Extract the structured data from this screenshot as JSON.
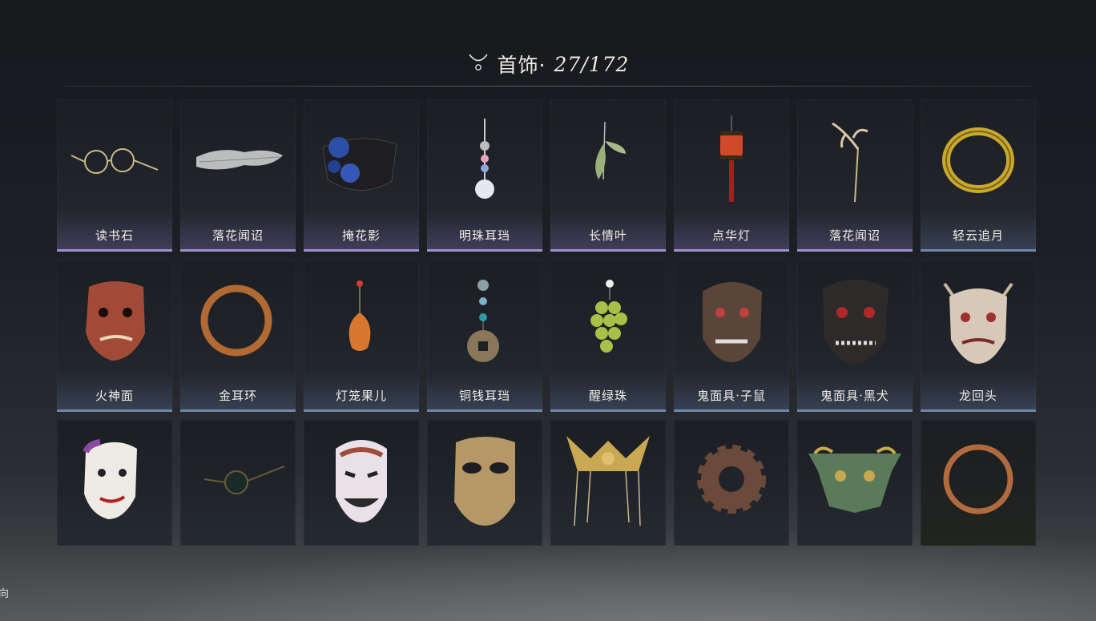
{
  "header": {
    "category": "首饰·",
    "count": "27/172",
    "icon": "necklace-icon"
  },
  "rows": [
    [
      {
        "label": "读书石",
        "icon": "glasses-icon"
      },
      {
        "label": "落花闻诏",
        "icon": "veil-icon"
      },
      {
        "label": "掩花影",
        "icon": "flower-mask-icon"
      },
      {
        "label": "明珠耳珰",
        "icon": "pearl-earring-icon"
      },
      {
        "label": "长情叶",
        "icon": "leaf-hairpin-icon"
      },
      {
        "label": "点华灯",
        "icon": "lantern-icon"
      },
      {
        "label": "落花闻诏",
        "icon": "antler-hairpin-icon"
      },
      {
        "label": "轻云追月",
        "icon": "gold-bracelet-icon"
      }
    ],
    [
      {
        "label": "火神面",
        "icon": "fire-god-mask-icon"
      },
      {
        "label": "金耳环",
        "icon": "copper-ring-icon"
      },
      {
        "label": "灯笼果儿",
        "icon": "fruit-pendant-icon"
      },
      {
        "label": "铜钱耳珰",
        "icon": "coin-earring-icon"
      },
      {
        "label": "醒绿珠",
        "icon": "grape-pendant-icon"
      },
      {
        "label": "鬼面具·子鼠",
        "icon": "rat-demon-mask-icon"
      },
      {
        "label": "鬼面具·黑犬",
        "icon": "dog-demon-mask-icon"
      },
      {
        "label": "龙回头",
        "icon": "dragon-mask-icon"
      }
    ],
    [
      {
        "label": "",
        "icon": "opera-mask-icon"
      },
      {
        "label": "",
        "icon": "round-glasses-icon"
      },
      {
        "label": "",
        "icon": "smile-mask-icon"
      },
      {
        "label": "",
        "icon": "leather-mask-icon"
      },
      {
        "label": "",
        "icon": "crown-icon"
      },
      {
        "label": "",
        "icon": "gear-ring-icon"
      },
      {
        "label": "",
        "icon": "bronze-mask-icon"
      },
      {
        "label": "",
        "icon": "copper-ring-icon"
      }
    ]
  ],
  "edge_text": "向"
}
